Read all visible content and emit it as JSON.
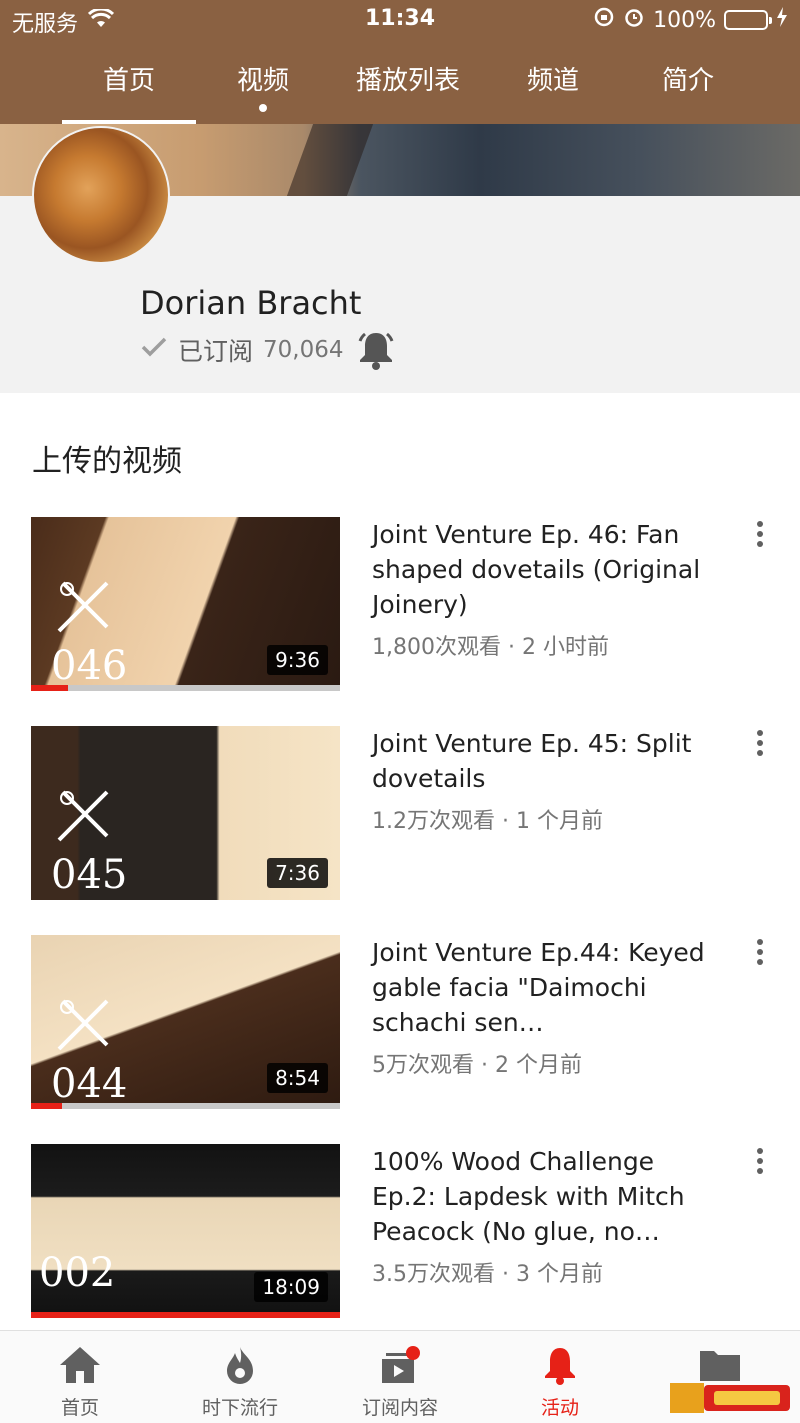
{
  "status_bar": {
    "carrier": "无服务",
    "time": "11:34",
    "battery": "100%",
    "battery_level": 1.0
  },
  "tabs": [
    {
      "label": "首页",
      "active": true
    },
    {
      "label": "视频",
      "has_dot": true
    },
    {
      "label": "播放列表"
    },
    {
      "label": "频道"
    },
    {
      "label": "简介"
    }
  ],
  "channel": {
    "name": "Dorian Bracht",
    "subscribed_label": "已订阅",
    "subscriber_count": "70,064"
  },
  "section_title": "上传的视频",
  "videos": [
    {
      "title": "Joint Venture Ep. 46: Fan shaped dovetails (Original Joinery)",
      "meta": "1,800次观看 · 2 小时前",
      "duration": "9:36",
      "thumb_number": "046",
      "watched_fraction": 0.12
    },
    {
      "title": "Joint Venture Ep. 45: Split dovetails",
      "meta": "1.2万次观看 · 1 个月前",
      "duration": "7:36",
      "thumb_number": "045",
      "watched_fraction": 0
    },
    {
      "title": "Joint Venture Ep.44: Keyed gable facia \"Daimochi schachi sen…",
      "meta": "5万次观看 · 2 个月前",
      "duration": "8:54",
      "thumb_number": "044",
      "watched_fraction": 0.1
    },
    {
      "title": "100% Wood Challenge Ep.2: Lapdesk with Mitch Peacock (No glue, no…",
      "meta": "3.5万次观看 · 3 个月前",
      "duration": "18:09",
      "thumb_number": "002",
      "watched_fraction": 1.0
    }
  ],
  "bottom_nav": [
    {
      "label": "首页",
      "icon": "home-icon"
    },
    {
      "label": "时下流行",
      "icon": "trending-icon"
    },
    {
      "label": "订阅内容",
      "icon": "subscriptions-icon"
    },
    {
      "label": "活动",
      "icon": "activity-bell-icon",
      "active": true
    },
    {
      "label": "",
      "icon": "library-folder-icon"
    }
  ],
  "colors": {
    "header": "#8a6142",
    "accent_red": "#e62117",
    "battery_green": "#4cd964"
  }
}
